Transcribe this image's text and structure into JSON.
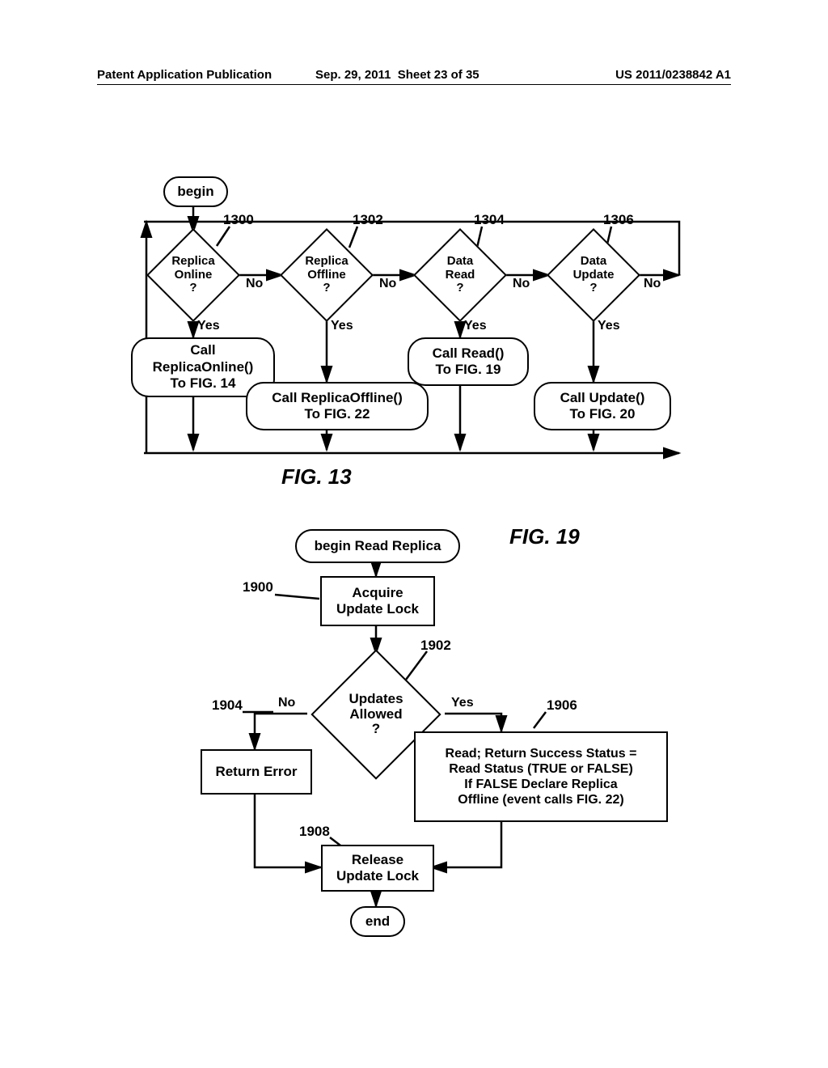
{
  "header": {
    "left": "Patent Application Publication",
    "date": "Sep. 29, 2011",
    "sheet": "Sheet 23 of 35",
    "pubno": "US 2011/0238842 A1"
  },
  "fig13": {
    "title": "FIG. 13",
    "begin": "begin",
    "decisions": {
      "d1300": {
        "ref": "1300",
        "text": "Replica\nOnline\n?"
      },
      "d1302": {
        "ref": "1302",
        "text": "Replica\nOffline\n?"
      },
      "d1304": {
        "ref": "1304",
        "text": "Data\nRead\n?"
      },
      "d1306": {
        "ref": "1306",
        "text": "Data\nUpdate\n?"
      }
    },
    "edges": {
      "no": "No",
      "yes": "Yes"
    },
    "calls": {
      "c_online": "Call\nReplicaOnline()\nTo FIG. 14",
      "c_offline": "Call ReplicaOffline()\nTo FIG. 22",
      "c_read": "Call Read()\nTo FIG. 19",
      "c_update": "Call Update()\nTo FIG. 20"
    }
  },
  "fig19": {
    "title": "FIG. 19",
    "begin": "begin Read Replica",
    "p1900": {
      "ref": "1900",
      "text": "Acquire\nUpdate Lock"
    },
    "d1902": {
      "ref": "1902",
      "text": "Updates\nAllowed\n?"
    },
    "b1904": {
      "ref": "1904",
      "text": "Return Error"
    },
    "b1906": {
      "ref": "1906",
      "text": "Read; Return Success Status =\nRead Status (TRUE or FALSE)\nIf FALSE Declare Replica\nOffline (event calls FIG. 22)"
    },
    "p1908": {
      "ref": "1908",
      "text": "Release\nUpdate Lock"
    },
    "end": "end",
    "edges": {
      "no": "No",
      "yes": "Yes"
    }
  }
}
